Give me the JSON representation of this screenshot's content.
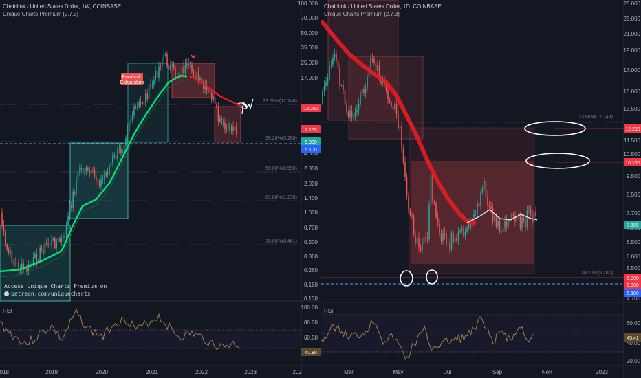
{
  "left_chart": {
    "title": "Chainlink / United States Dollar, 1W, COINBASE",
    "indicator": "Unique Charts Premium [2.7.3]",
    "price_labels": [
      "100.000",
      "70.000",
      "50.000",
      "35.000",
      "25.000",
      "17.000",
      "12.000",
      "8.000",
      "4.000",
      "2.800",
      "2.000",
      "1.400",
      "1.000",
      "0.700",
      "0.500",
      "0.360",
      "0.260",
      "0.180",
      "0.130"
    ],
    "fib_labels": [
      "23.60%(12.748)",
      "38.20%(5.280)",
      "50.00%(2.590)",
      "61.80%(1.270)",
      "78.60%(0.461)"
    ],
    "price_tags": {
      "red": "12.290",
      "current": "7.155",
      "teal": "5.300",
      "blue": "5.100"
    },
    "parabolic_tag": [
      "Parabolic",
      "Exhaustion"
    ],
    "promo_line1": "Access Unique Charts Premium on",
    "promo_line2": "patreon.com/uniquecharts",
    "rsi_label": "RSI",
    "rsi_scale": [
      "100.00",
      "80.00",
      "60.00",
      "40.00"
    ],
    "rsi_value": "41.80",
    "time_labels": [
      "2018",
      "2019",
      "2020",
      "2021",
      "2022",
      "2023",
      "202"
    ]
  },
  "right_chart": {
    "title": "Chainlink / United States Dollar, 1D, COINBASE",
    "indicator": "Unique Charts Premium [2.7.3]",
    "price_labels": [
      "25.000",
      "23.000",
      "21.000",
      "19.000",
      "17.000",
      "15.000",
      "13.500",
      "12.000",
      "11.500",
      "10.500",
      "9.500",
      "8.500",
      "7.700",
      "7.000",
      "6.500",
      "6.000",
      "5.500",
      "5.300",
      "5.000",
      "4.700"
    ],
    "fib_labels": [
      "23.60%(12.748)",
      "38.20%(5.280)"
    ],
    "price_tags": {
      "red": "12.290",
      "red2": "10.160",
      "current": "7.155",
      "teal": "5.300",
      "teal2": "5.300",
      "blue": "5.100"
    },
    "rsi_label": "RSI",
    "rsi_scale": [
      "60.00",
      "40.00",
      "20.00"
    ],
    "rsi_value": "45.41",
    "time_labels": [
      "Mar",
      "May",
      "Jul",
      "Sep",
      "Nov",
      "2023"
    ]
  },
  "colors": {
    "background": "#131722",
    "bull": "#26a69a",
    "bear": "#ef5350",
    "ema_green": "#00e676",
    "ema_red": "#e51c23",
    "rsi_line": "#a0804a",
    "fib_line": "#787b86",
    "blue_dash": "#5b9cf6"
  }
}
